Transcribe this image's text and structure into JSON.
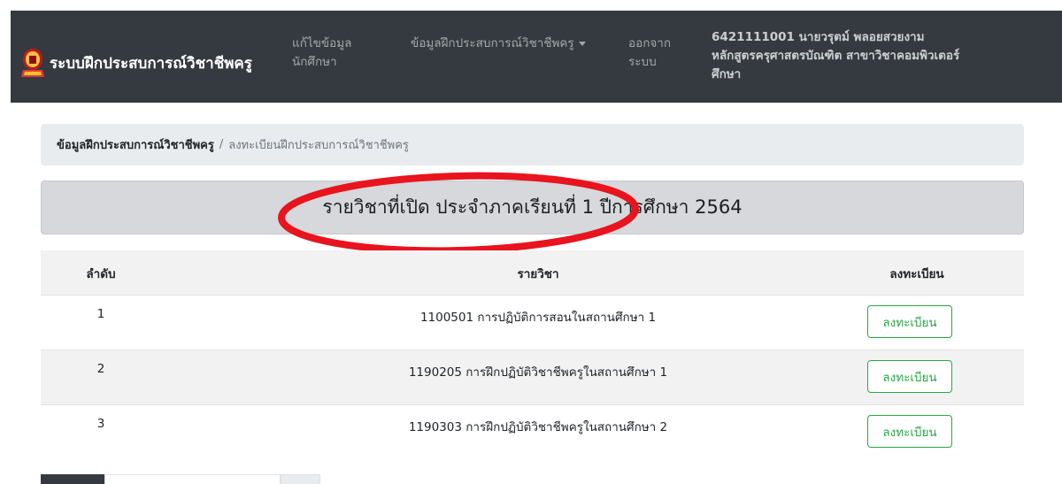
{
  "navbar": {
    "brand": "ระบบฝึกประสบการณ์วิชาชีพครู",
    "edit_line1": "แก้ไขข้อมูล",
    "edit_line2": "นักศึกษา",
    "training_menu": "ข้อมูลฝึกประสบการณ์วิชาชีพครู",
    "logout_line1": "ออกจาก",
    "logout_line2": "ระบบ",
    "user_line1": "6421111001 นายวรุตม์ พลอยสวยงาม",
    "user_line2": "หลักสูตรครุศาสตรบัณฑิต สาขาวิชาคอมพิวเตอร์",
    "user_line3": "ศึกษา"
  },
  "breadcrumb": {
    "parent": "ข้อมูลฝึกประสบการณ์วิชาชีพครู",
    "separator": "/",
    "current": "ลงทะเบียนฝึกประสบการณ์วิชาชีพครู"
  },
  "title": "รายวิชาที่เปิด ประจำภาคเรียนที่ 1 ปีการศึกษา 2564",
  "table": {
    "headers": {
      "no": "ลำดับ",
      "subject": "รายวิชา",
      "register": "ลงทะเบียน"
    },
    "rows": [
      {
        "no": "1",
        "subject": "1100501 การปฏิบัติการสอนในสถานศึกษา 1",
        "button": "ลงทะเบียน"
      },
      {
        "no": "2",
        "subject": "1190205 การฝึกปฏิบัติวิชาชีพครูในสถานศึกษา 1",
        "button": "ลงทะเบียน"
      },
      {
        "no": "3",
        "subject": "1190303 การฝึกปฏิบัติวิชาชีพครูในสถานศึกษา 2",
        "button": "ลงทะเบียน"
      }
    ]
  },
  "colors": {
    "navbar_bg": "#343a40",
    "breadcrumb_bg": "#e9ecef",
    "title_bg": "#d6d8db",
    "row_stripe": "#f2f2f2",
    "success": "#28a745",
    "highlight_ring": "#e8141e"
  }
}
